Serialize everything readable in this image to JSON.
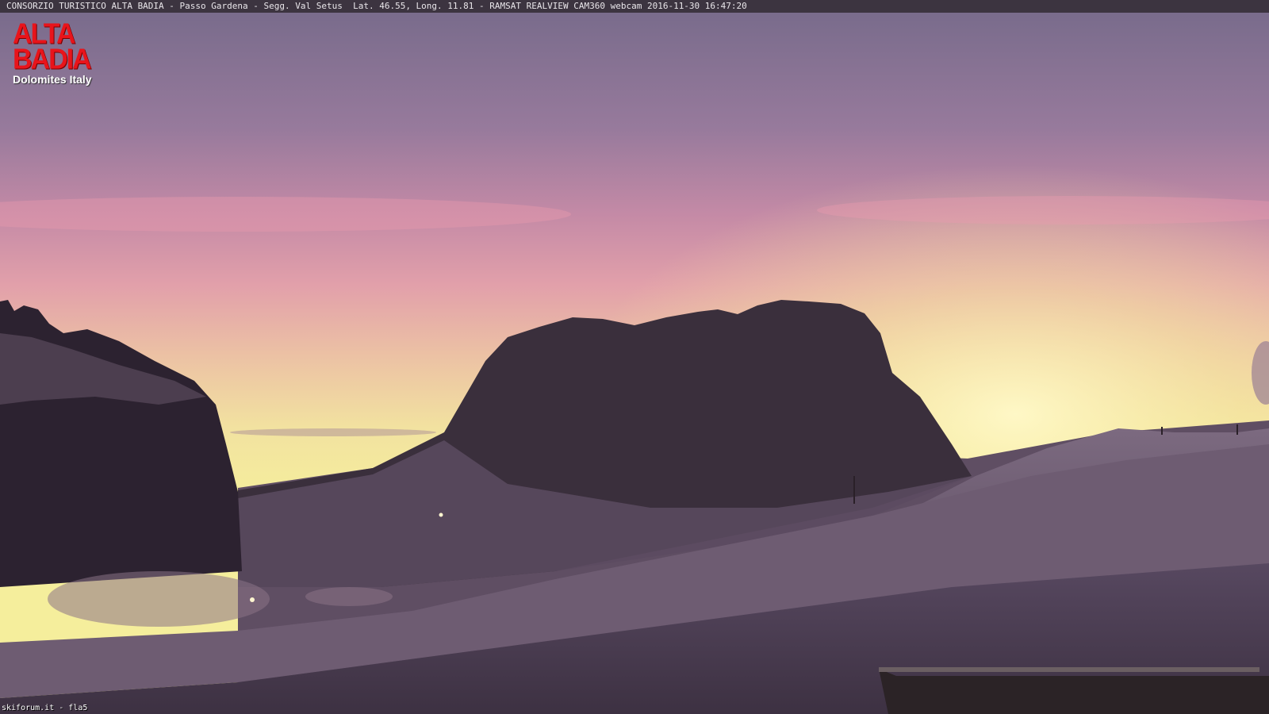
{
  "camera": {
    "info_text": "CONSORZIO TURISTICO ALTA BADIA - Passo Gardena - Segg. Val Setus  Lat. 46.55, Long. 11.81 - RAMSAT REALVIEW CAM360 webcam 2016-11-30 16:47:20"
  },
  "logo": {
    "line1": "ALTA",
    "line2": "BADIA",
    "tagline": "Dolomites Italy",
    "color": "#e8141b"
  },
  "watermark": {
    "text": "skiforum.it - fla5"
  },
  "colors": {
    "sky_top": "#7a6a8c",
    "sky_pink": "#c88aa8",
    "sky_glow": "#f4ee9a",
    "mountain": "#2f2530",
    "snow": "#6d5c72"
  }
}
